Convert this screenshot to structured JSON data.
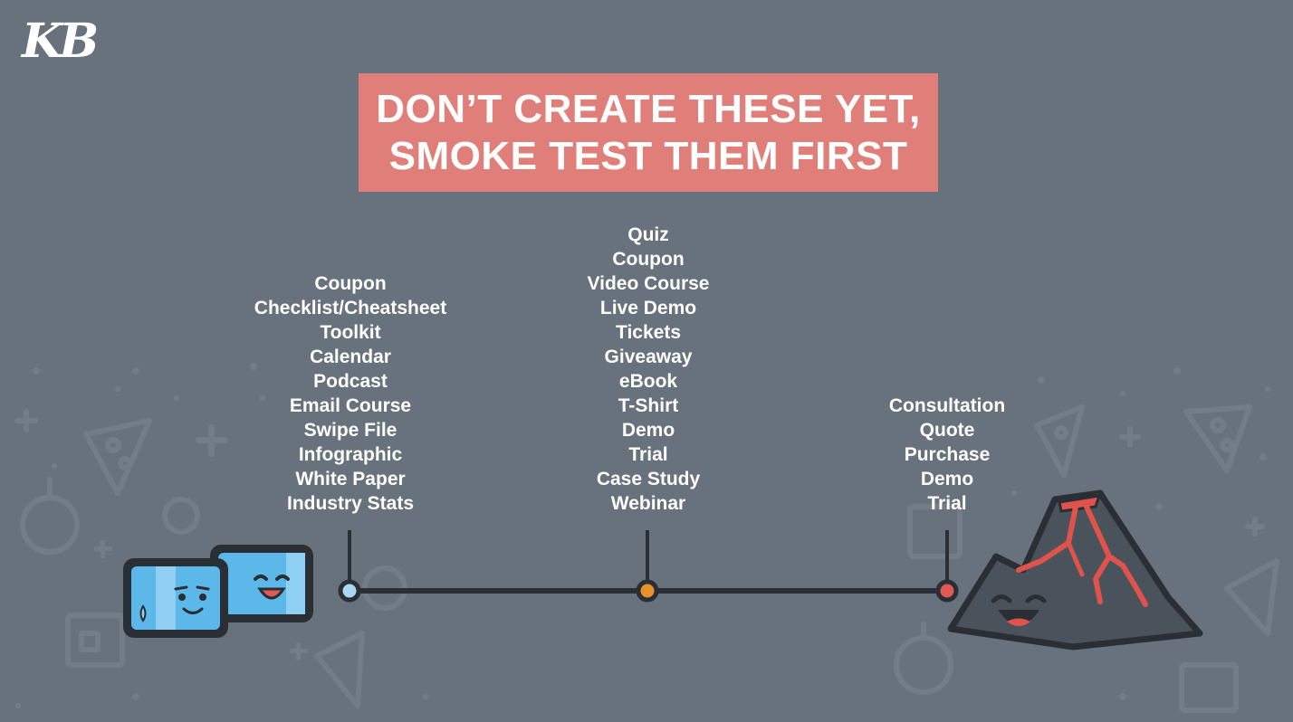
{
  "logo": {
    "text": "KB"
  },
  "title": {
    "line1": "DON’T CREATE THESE YET,",
    "line2": "SMOKE TEST THEM FIRST"
  },
  "columns": [
    {
      "stage": "left",
      "marker_color": "#a8d8f0",
      "items": [
        "Coupon",
        "Checklist/Cheatsheet",
        "Toolkit",
        "Calendar",
        "Podcast",
        "Email Course",
        "Swipe File",
        "Infographic",
        "White Paper",
        "Industry Stats"
      ]
    },
    {
      "stage": "middle",
      "marker_color": "#e8902c",
      "items": [
        "Quiz",
        "Coupon",
        "Video Course",
        "Live Demo",
        "Tickets",
        "Giveaway",
        "eBook",
        "T-Shirt",
        "Demo",
        "Trial",
        "Case Study",
        "Webinar"
      ]
    },
    {
      "stage": "right",
      "marker_color": "#e05a54",
      "items": [
        "Consultation",
        "Quote",
        "Purchase",
        "Demo",
        "Trial"
      ]
    }
  ],
  "colors": {
    "background": "#67727d",
    "title_box": "#e07f7a",
    "text": "#ffffff",
    "line": "#2a2f36",
    "ice_cube": "#5bb8e8",
    "volcano": "#4a525c",
    "lava": "#e0524c"
  },
  "icons": [
    "ice-cube-icon",
    "volcano-icon",
    "pizza-icon",
    "onion-icon",
    "plus-icon",
    "storefront-icon",
    "clock-icon"
  ]
}
